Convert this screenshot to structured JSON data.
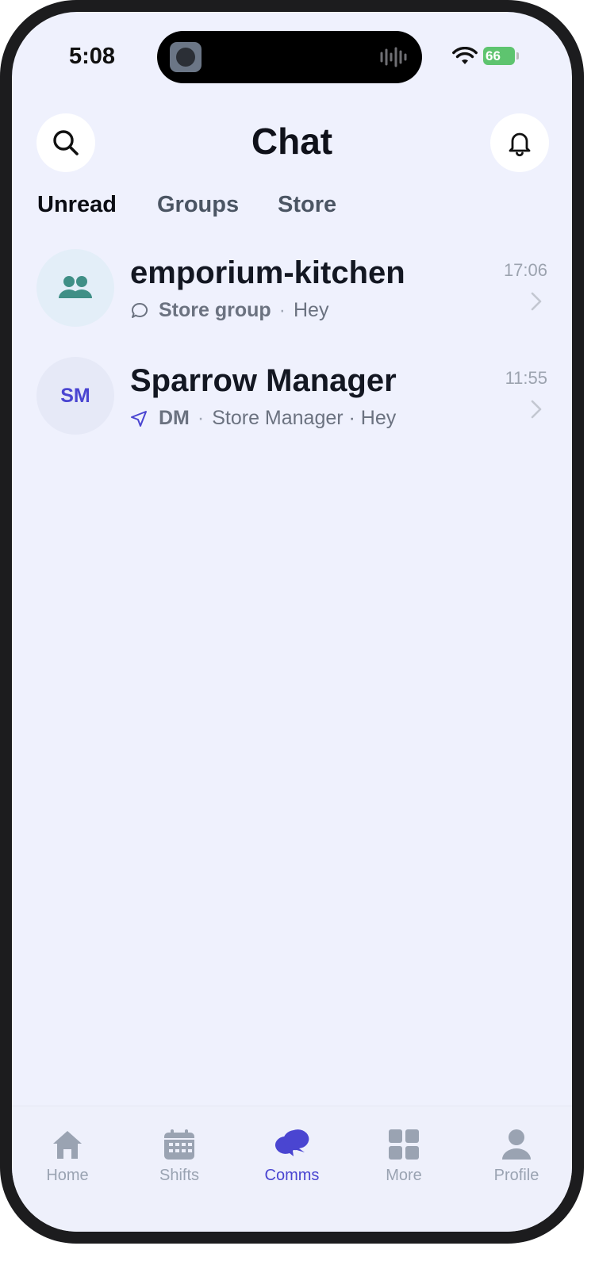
{
  "status_bar": {
    "time": "5:08",
    "battery": "66"
  },
  "header": {
    "title": "Chat"
  },
  "tabs": [
    {
      "label": "Unread",
      "active": true
    },
    {
      "label": "Groups",
      "active": false
    },
    {
      "label": "Store",
      "active": false
    }
  ],
  "chats": [
    {
      "name": "emporium-kitchen",
      "avatar": "group-icon",
      "kind_icon": "chat-bubble-icon",
      "kind": "Store group",
      "detail": "Hey",
      "time": "17:06"
    },
    {
      "name": "Sparrow Manager",
      "initials": "SM",
      "kind_icon": "send-arrow-icon",
      "kind": "DM",
      "detail": "Store Manager · Hey",
      "time": "11:55"
    }
  ],
  "nav": [
    {
      "label": "Home",
      "icon": "home-icon",
      "active": false
    },
    {
      "label": "Shifts",
      "icon": "calendar-icon",
      "active": false
    },
    {
      "label": "Comms",
      "icon": "chat-bubbles-icon",
      "active": true
    },
    {
      "label": "More",
      "icon": "grid-icon",
      "active": false
    },
    {
      "label": "Profile",
      "icon": "person-icon",
      "active": false
    }
  ],
  "colors": {
    "accent": "#4a45d1",
    "background": "#eff1fd",
    "group_icon": "#3f8f86"
  }
}
